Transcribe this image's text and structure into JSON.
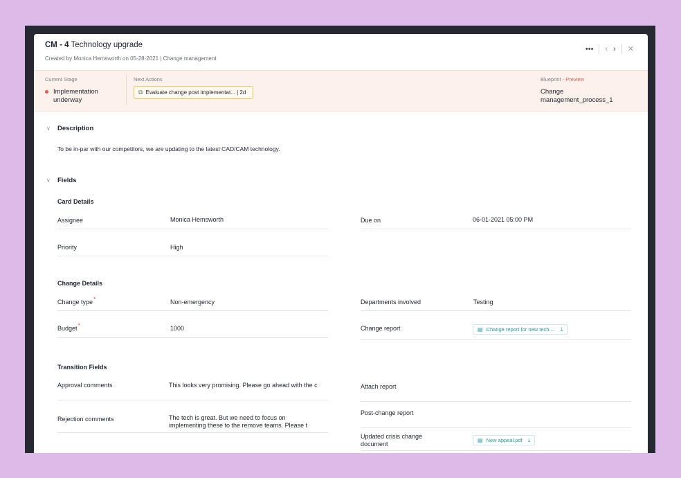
{
  "header": {
    "key": "CM - 4",
    "title": "Technology upgrade",
    "subtitle": "Created by Monica Hemsworth on 05-28-2021 | Change management",
    "more_icon": "more-horizontal-icon",
    "prev_icon": "chevron-left-icon",
    "next_icon": "chevron-right-icon",
    "close_icon": "close-icon"
  },
  "stage": {
    "current_label": "Current Stage",
    "current_value": "Implementation underway",
    "status_color": "#e8584d",
    "next_label": "Next Actions",
    "next_action": "Evaluate change post implementat...  |  2d",
    "blueprint_label": "Blueprint",
    "blueprint_preview": "- Preview",
    "blueprint_value": "Change management_process_1"
  },
  "description": {
    "heading": "Description",
    "text": "To be in-par with our competitors, we are updating to the latest CAD/CAM technology."
  },
  "fields": {
    "heading": "Fields",
    "card_details": {
      "title": "Card Details",
      "assignee_label": "Assignee",
      "assignee_value": "Monica Hemsworth",
      "due_label": "Due on",
      "due_value": "06-01-2021 05:00 PM",
      "priority_label": "Priority",
      "priority_value": "High"
    },
    "change_details": {
      "title": "Change Details",
      "change_type_label": "Change type",
      "change_type_value": "Non-emergency",
      "departments_label": "Departments involved",
      "departments_value": "Testing",
      "budget_label": "Budget",
      "budget_value": "1000",
      "report_label": "Change report",
      "report_file": "Change report for new tech...."
    },
    "transition": {
      "title": "Transition Fields",
      "approval_label": "Approval comments",
      "approval_value": "This looks very promising. Please go ahead with the c",
      "attach_label": "Attach report",
      "rejection_label": "Rejection comments",
      "rejection_value_1": "The tech is great. But we need to focus on",
      "rejection_value_2": "implementing these to the remove teams. Please t",
      "post_change_label": "Post-change report",
      "crisis_label": "Updated crisis change document",
      "crisis_file": "New appeal.pdf"
    }
  }
}
